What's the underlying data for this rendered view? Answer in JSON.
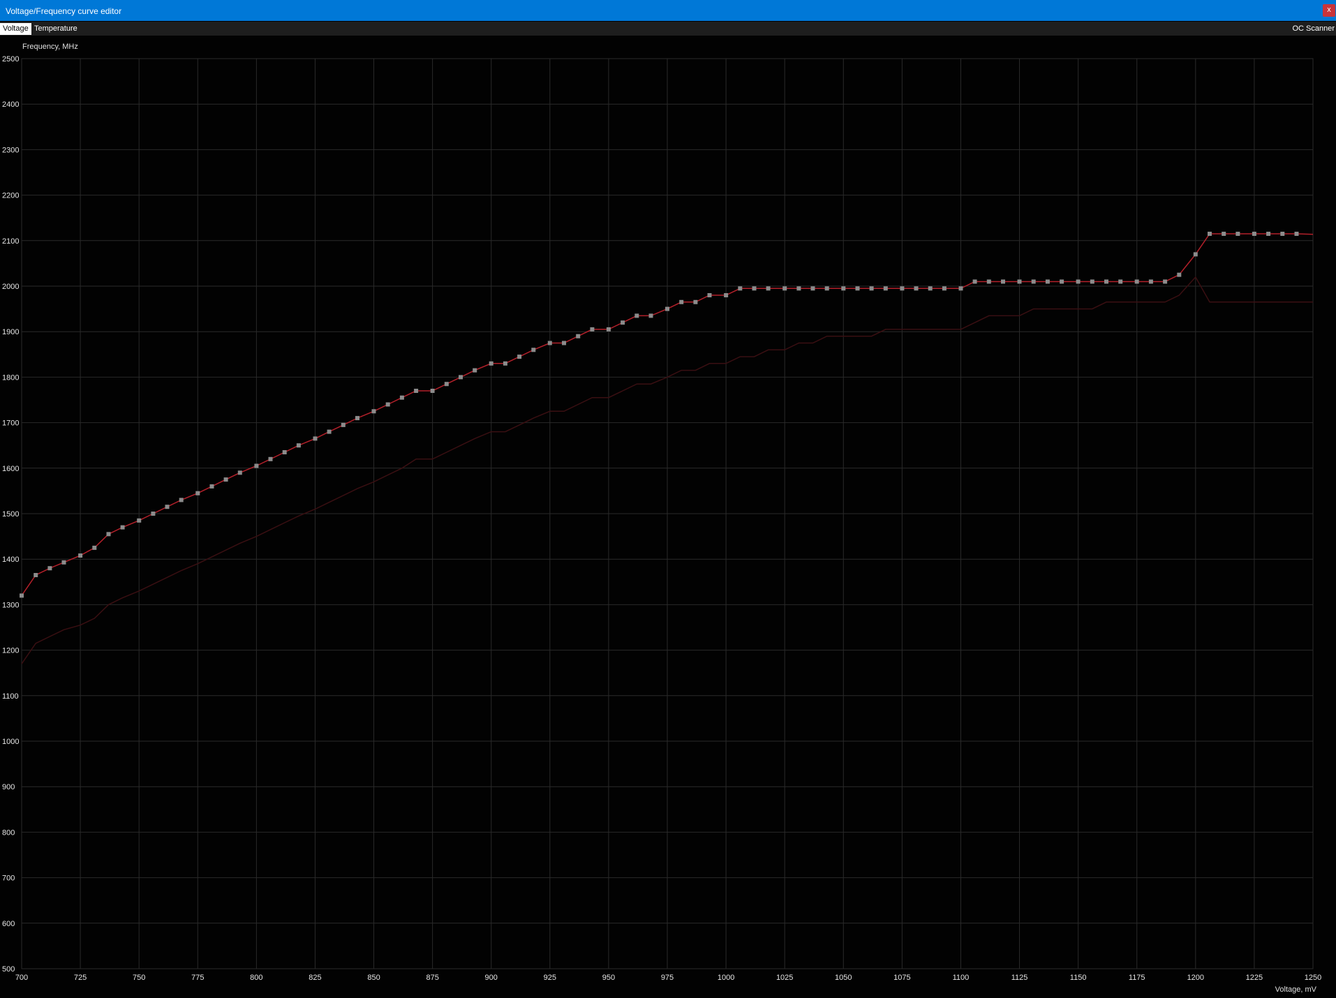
{
  "window": {
    "title": "Voltage/Frequency curve editor",
    "close_label": "x"
  },
  "tabs": [
    {
      "label": "Voltage",
      "active": true
    },
    {
      "label": "Temperature",
      "active": false
    }
  ],
  "oc_scanner_label": "OC Scanner",
  "colors": {
    "titlebar": "#0078d7",
    "close_button": "#c9343a",
    "background": "#020202",
    "grid": "#2a2a2a",
    "curve": "#b3202a",
    "baseline": "#3a0f12",
    "point": "#8c8c8c"
  },
  "chart_data": {
    "type": "line",
    "ylabel": "Frequency, MHz",
    "xlabel": "Voltage, mV",
    "xlim": [
      700,
      1250
    ],
    "ylim": [
      500,
      2500
    ],
    "xticks": [
      700,
      725,
      750,
      775,
      800,
      825,
      850,
      875,
      900,
      925,
      950,
      975,
      1000,
      1025,
      1050,
      1075,
      1100,
      1125,
      1150,
      1175,
      1200,
      1225,
      1250
    ],
    "yticks": [
      500,
      600,
      700,
      800,
      900,
      1000,
      1100,
      1200,
      1300,
      1400,
      1500,
      1600,
      1700,
      1800,
      1900,
      2000,
      2100,
      2200,
      2300,
      2400,
      2500
    ],
    "grid": true,
    "series": [
      {
        "role": "current",
        "markers": true,
        "points": [
          [
            700,
            1320
          ],
          [
            706,
            1365
          ],
          [
            712,
            1380
          ],
          [
            718,
            1393
          ],
          [
            725,
            1408
          ],
          [
            731,
            1425
          ],
          [
            737,
            1455
          ],
          [
            743,
            1470
          ],
          [
            750,
            1485
          ],
          [
            756,
            1500
          ],
          [
            762,
            1515
          ],
          [
            768,
            1530
          ],
          [
            775,
            1545
          ],
          [
            781,
            1560
          ],
          [
            787,
            1575
          ],
          [
            793,
            1590
          ],
          [
            800,
            1605
          ],
          [
            806,
            1620
          ],
          [
            812,
            1635
          ],
          [
            818,
            1650
          ],
          [
            825,
            1665
          ],
          [
            831,
            1680
          ],
          [
            837,
            1695
          ],
          [
            843,
            1710
          ],
          [
            850,
            1725
          ],
          [
            856,
            1740
          ],
          [
            862,
            1755
          ],
          [
            868,
            1770
          ],
          [
            875,
            1770
          ],
          [
            881,
            1785
          ],
          [
            887,
            1800
          ],
          [
            893,
            1815
          ],
          [
            900,
            1830
          ],
          [
            906,
            1830
          ],
          [
            912,
            1845
          ],
          [
            918,
            1860
          ],
          [
            925,
            1875
          ],
          [
            931,
            1875
          ],
          [
            937,
            1890
          ],
          [
            943,
            1905
          ],
          [
            950,
            1905
          ],
          [
            956,
            1920
          ],
          [
            962,
            1935
          ],
          [
            968,
            1935
          ],
          [
            975,
            1950
          ],
          [
            981,
            1965
          ],
          [
            987,
            1965
          ],
          [
            993,
            1980
          ],
          [
            1000,
            1980
          ],
          [
            1006,
            1995
          ],
          [
            1012,
            1995
          ],
          [
            1018,
            1995
          ],
          [
            1025,
            1995
          ],
          [
            1031,
            1995
          ],
          [
            1037,
            1995
          ],
          [
            1043,
            1995
          ],
          [
            1050,
            1995
          ],
          [
            1056,
            1995
          ],
          [
            1062,
            1995
          ],
          [
            1068,
            1995
          ],
          [
            1075,
            1995
          ],
          [
            1081,
            1995
          ],
          [
            1087,
            1995
          ],
          [
            1093,
            1995
          ],
          [
            1100,
            1995
          ],
          [
            1106,
            2010
          ],
          [
            1112,
            2010
          ],
          [
            1118,
            2010
          ],
          [
            1125,
            2010
          ],
          [
            1131,
            2010
          ],
          [
            1137,
            2010
          ],
          [
            1143,
            2010
          ],
          [
            1150,
            2010
          ],
          [
            1156,
            2010
          ],
          [
            1162,
            2010
          ],
          [
            1168,
            2010
          ],
          [
            1175,
            2010
          ],
          [
            1181,
            2010
          ],
          [
            1187,
            2010
          ],
          [
            1193,
            2025
          ],
          [
            1200,
            2070
          ],
          [
            1206,
            2115
          ],
          [
            1212,
            2115
          ],
          [
            1218,
            2115
          ],
          [
            1225,
            2115
          ],
          [
            1231,
            2115
          ],
          [
            1237,
            2115
          ],
          [
            1243,
            2115
          ]
        ],
        "tail": [
          1250,
          2114
        ]
      },
      {
        "role": "default",
        "markers": false,
        "points": [
          [
            700,
            1170
          ],
          [
            706,
            1215
          ],
          [
            712,
            1230
          ],
          [
            718,
            1245
          ],
          [
            725,
            1255
          ],
          [
            731,
            1270
          ],
          [
            737,
            1300
          ],
          [
            743,
            1315
          ],
          [
            750,
            1330
          ],
          [
            756,
            1345
          ],
          [
            762,
            1360
          ],
          [
            768,
            1375
          ],
          [
            775,
            1390
          ],
          [
            781,
            1405
          ],
          [
            787,
            1420
          ],
          [
            793,
            1435
          ],
          [
            800,
            1450
          ],
          [
            806,
            1465
          ],
          [
            812,
            1480
          ],
          [
            818,
            1495
          ],
          [
            825,
            1510
          ],
          [
            831,
            1525
          ],
          [
            837,
            1540
          ],
          [
            843,
            1555
          ],
          [
            850,
            1570
          ],
          [
            856,
            1585
          ],
          [
            862,
            1600
          ],
          [
            868,
            1620
          ],
          [
            875,
            1620
          ],
          [
            881,
            1635
          ],
          [
            887,
            1650
          ],
          [
            893,
            1665
          ],
          [
            900,
            1680
          ],
          [
            906,
            1680
          ],
          [
            912,
            1695
          ],
          [
            918,
            1710
          ],
          [
            925,
            1725
          ],
          [
            931,
            1725
          ],
          [
            937,
            1740
          ],
          [
            943,
            1755
          ],
          [
            950,
            1755
          ],
          [
            956,
            1770
          ],
          [
            962,
            1785
          ],
          [
            968,
            1785
          ],
          [
            975,
            1800
          ],
          [
            981,
            1815
          ],
          [
            987,
            1815
          ],
          [
            993,
            1830
          ],
          [
            1000,
            1830
          ],
          [
            1006,
            1845
          ],
          [
            1012,
            1845
          ],
          [
            1018,
            1860
          ],
          [
            1025,
            1860
          ],
          [
            1031,
            1875
          ],
          [
            1037,
            1875
          ],
          [
            1043,
            1890
          ],
          [
            1050,
            1890
          ],
          [
            1056,
            1890
          ],
          [
            1062,
            1890
          ],
          [
            1068,
            1905
          ],
          [
            1075,
            1905
          ],
          [
            1081,
            1905
          ],
          [
            1087,
            1905
          ],
          [
            1093,
            1905
          ],
          [
            1100,
            1905
          ],
          [
            1106,
            1920
          ],
          [
            1112,
            1935
          ],
          [
            1118,
            1935
          ],
          [
            1125,
            1935
          ],
          [
            1131,
            1950
          ],
          [
            1137,
            1950
          ],
          [
            1143,
            1950
          ],
          [
            1150,
            1950
          ],
          [
            1156,
            1950
          ],
          [
            1162,
            1965
          ],
          [
            1168,
            1965
          ],
          [
            1175,
            1965
          ],
          [
            1181,
            1965
          ],
          [
            1187,
            1965
          ],
          [
            1193,
            1980
          ],
          [
            1200,
            2020
          ],
          [
            1206,
            1965
          ],
          [
            1212,
            1965
          ],
          [
            1218,
            1965
          ],
          [
            1225,
            1965
          ],
          [
            1231,
            1965
          ],
          [
            1237,
            1965
          ],
          [
            1243,
            1965
          ],
          [
            1250,
            1965
          ]
        ]
      }
    ]
  }
}
